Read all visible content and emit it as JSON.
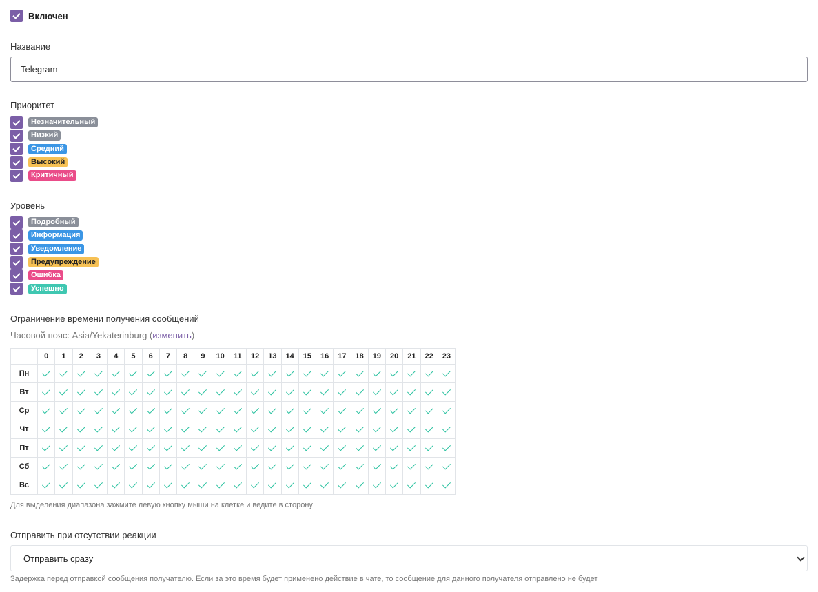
{
  "enabled": {
    "label": "Включен",
    "checked": true
  },
  "name": {
    "label": "Название",
    "value": "Telegram"
  },
  "priority": {
    "label": "Приоритет",
    "items": [
      {
        "label": "Незначительный",
        "color": "#8a8f99",
        "checked": true
      },
      {
        "label": "Низкий",
        "color": "#8a8f99",
        "checked": true
      },
      {
        "label": "Средний",
        "color": "#3b96e5",
        "checked": true
      },
      {
        "label": "Высокий",
        "color": "#f7c154",
        "checked": true
      },
      {
        "label": "Критичный",
        "color": "#ea4c89",
        "checked": true
      }
    ]
  },
  "level": {
    "label": "Уровень",
    "items": [
      {
        "label": "Подробный",
        "color": "#8a8f99",
        "checked": true
      },
      {
        "label": "Информация",
        "color": "#3b96e5",
        "checked": true
      },
      {
        "label": "Уведомление",
        "color": "#3b96e5",
        "checked": true
      },
      {
        "label": "Предупреждение",
        "color": "#f7c154",
        "checked": true
      },
      {
        "label": "Ошибка",
        "color": "#ea4c89",
        "checked": true
      },
      {
        "label": "Успешно",
        "color": "#3fc7b1",
        "checked": true
      }
    ]
  },
  "schedule": {
    "title": "Ограничение времени получения сообщений",
    "timezone_prefix": "Часовой пояс: Asia/Yekaterinburg (",
    "timezone_link": "изменить",
    "timezone_suffix": ")",
    "hours": [
      "0",
      "1",
      "2",
      "3",
      "4",
      "5",
      "6",
      "7",
      "8",
      "9",
      "10",
      "11",
      "12",
      "13",
      "14",
      "15",
      "16",
      "17",
      "18",
      "19",
      "20",
      "21",
      "22",
      "23"
    ],
    "days": [
      "Пн",
      "Вт",
      "Ср",
      "Чт",
      "Пт",
      "Сб",
      "Вс"
    ],
    "all_enabled": true,
    "hint": "Для выделения диапазона зажмите левую кнопку мыши на клетке и ведите в сторону"
  },
  "reaction": {
    "label": "Отправить при отсутствии реакции",
    "selected": "Отправить сразу",
    "hint": "Задержка перед отправкой сообщения получателю. Если за это время будет применено действие в чате, то сообщение для данного получателя отправлено не будет"
  },
  "colors": {
    "accent": "#7b5ea7",
    "check": "#2fc3a2"
  }
}
